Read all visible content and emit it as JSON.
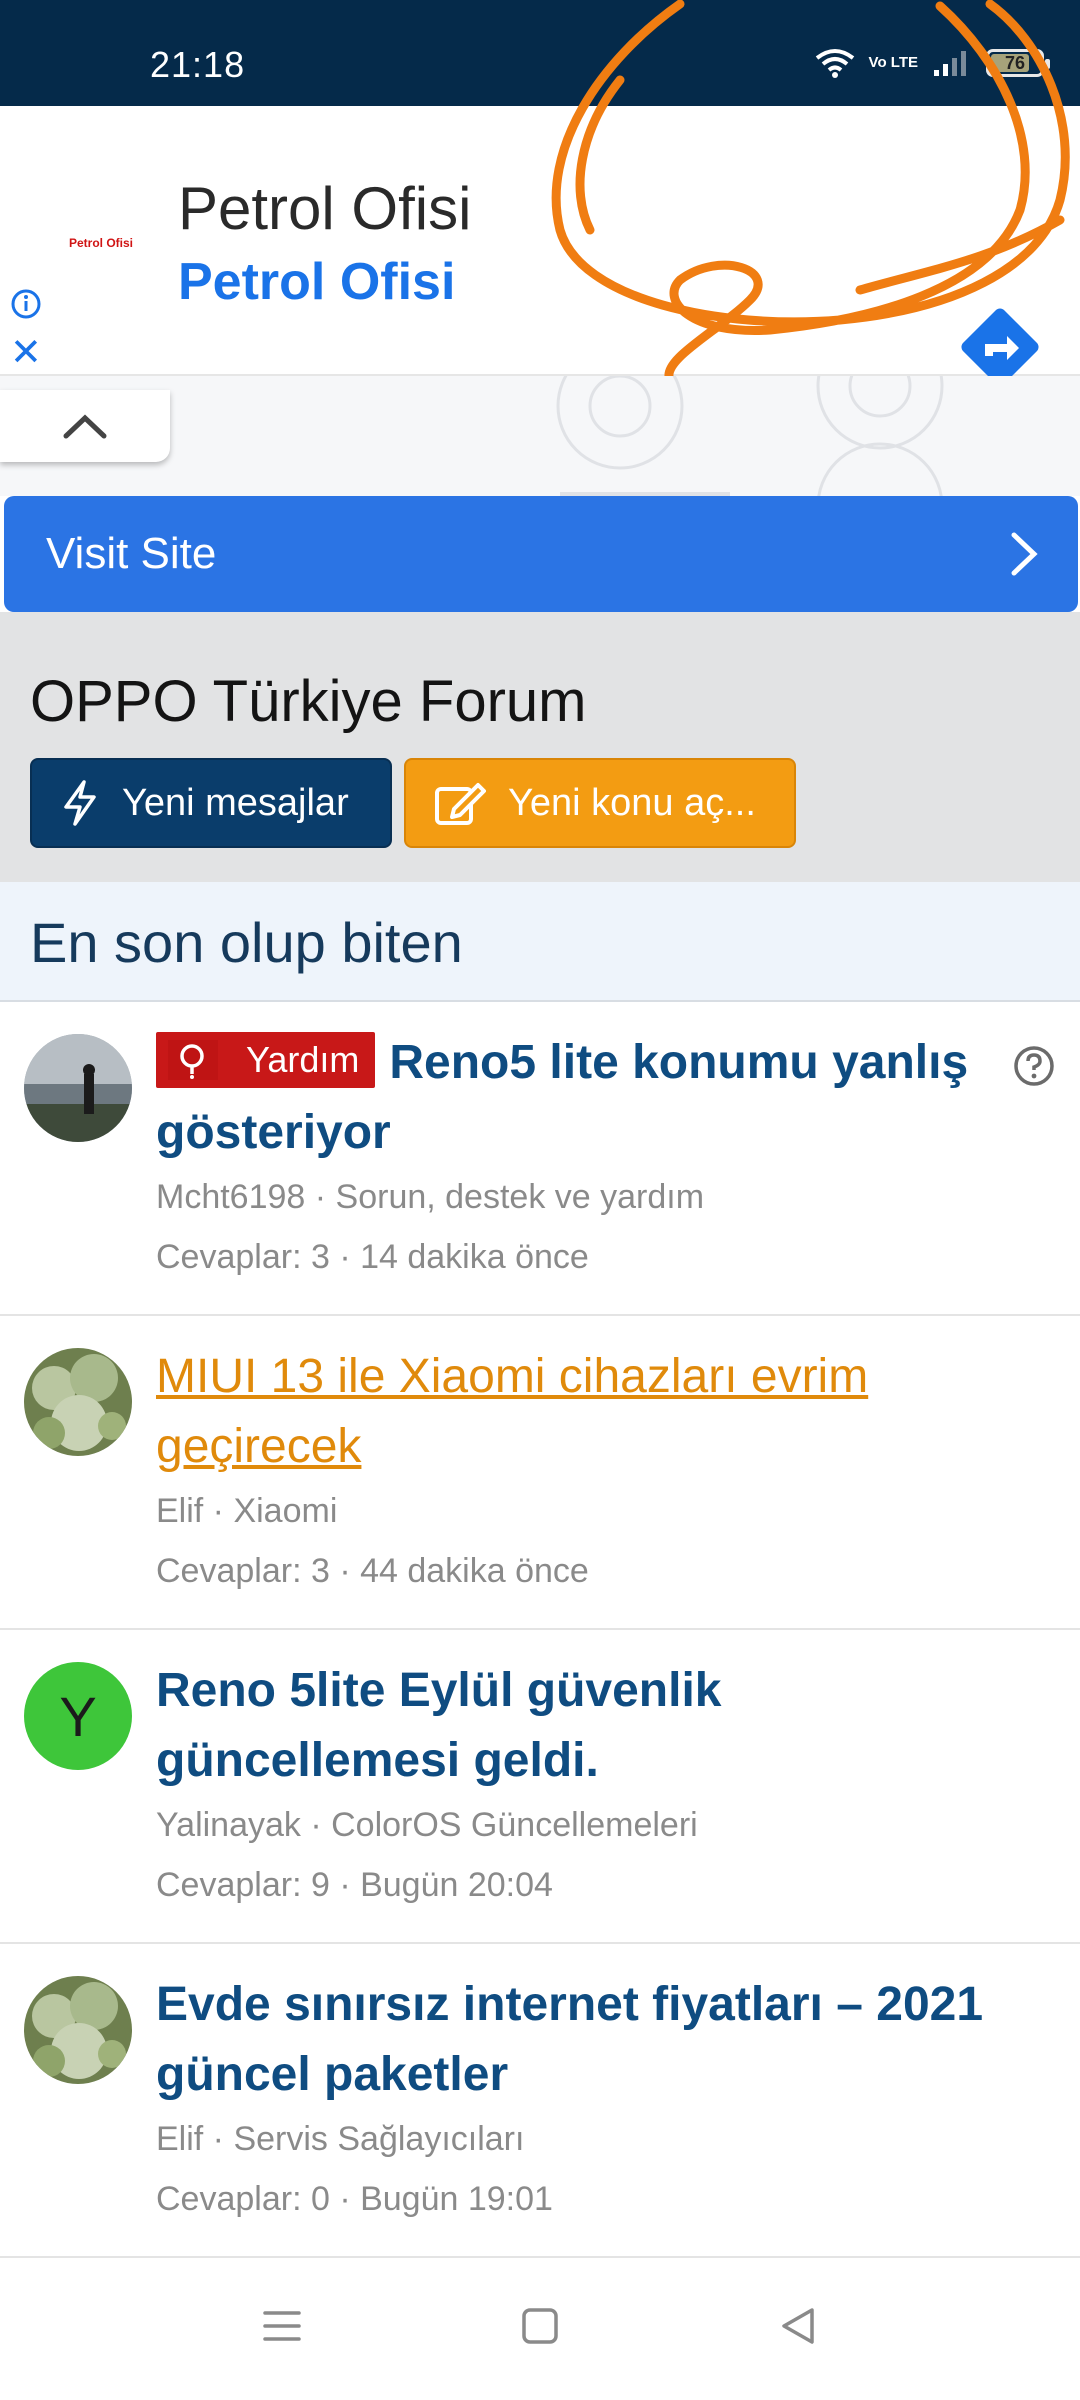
{
  "status_bar": {
    "time": "21:18",
    "network": "Vo LTE",
    "battery_level": "76"
  },
  "ad": {
    "logo_text": "Petrol Ofisi",
    "title": "Petrol Ofisi",
    "subtitle": "Petrol Ofisi",
    "visit_site_label": "Visit Site",
    "accent_color": "#1a73e8"
  },
  "forum": {
    "title": "OPPO Türkiye Forum",
    "new_messages_label": "Yeni mesajlar",
    "new_topic_label": "Yeni konu aç..."
  },
  "section": {
    "heading": "En son olup biten"
  },
  "threads": [
    {
      "prefix": "Yardım",
      "title": "Reno5 lite konumu yanlış gösteriyor",
      "meta": "Mcht6198 · Sorun, destek ve yardım",
      "stats": "Cevaplar: 3 · 14 dakika önce",
      "avatar": "photo-sea"
    },
    {
      "prefix": "",
      "title": "MIUI 13 ile Xiaomi cihazları evrim geçirecek",
      "meta": "Elif · Xiaomi",
      "stats": "Cevaplar: 3 · 44 dakika önce",
      "avatar": "photo-cactus"
    },
    {
      "prefix": "",
      "title": "Reno 5lite Eylül güvenlik güncellemesi geldi.",
      "meta": "Yalinayak · ColorOS Güncellemeleri",
      "stats": "Cevaplar: 9 · Bugün 20:04",
      "avatar_letter": "Y"
    },
    {
      "prefix": "",
      "title": "Evde sınırsız internet fiyatları – 2021 güncel paketler",
      "meta": "Elif · Servis Sağlayıcıları",
      "stats": "Cevaplar: 0 · Bugün 19:01",
      "avatar": "photo-cactus"
    }
  ],
  "colors": {
    "status_bar": "#052a4a",
    "primary_button": "#0a3d6b",
    "accent_button": "#f39c12",
    "link_blue": "#0f4c81",
    "prefix_red": "#c81818",
    "scribble_orange": "#f07d12"
  }
}
